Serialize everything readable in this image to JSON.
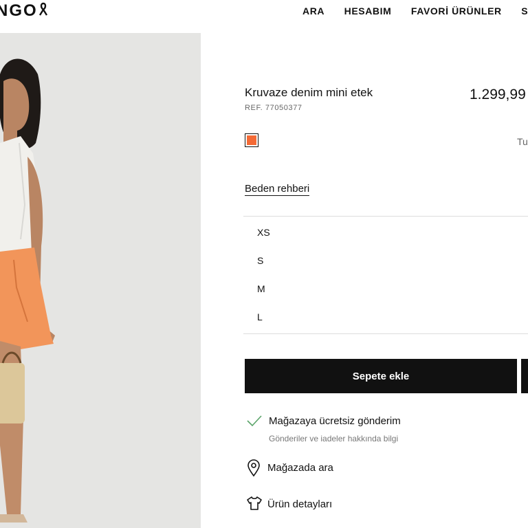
{
  "header": {
    "logo_text": "NGO",
    "nav": [
      {
        "label": "ARA"
      },
      {
        "label": "HESABIM"
      },
      {
        "label": "FAVORİ ÜRÜNLER"
      },
      {
        "label": "SEPE"
      }
    ]
  },
  "product": {
    "title": "Kruvaze denim mini etek",
    "ref": "REF. 77050377",
    "price": "1.299,99",
    "color_swatch": "#f46a36",
    "color_name": "Tu",
    "size_guide": "Beden rehberi",
    "sizes": [
      "XS",
      "S",
      "M",
      "L"
    ],
    "add_to_cart": "Sepete ekle",
    "shipping_title": "Mağazaya ücretsiz gönderim",
    "shipping_sub": "Gönderiler ve iadeler hakkında bilgi",
    "store_search": "Mağazada ara",
    "product_details": "Ürün detayları"
  },
  "icons": {
    "ship": "checkmark-icon",
    "store": "location-pin-icon",
    "details": "tshirt-icon"
  },
  "colors": {
    "accent": "#111111",
    "check": "#5aa469",
    "skirt": "#f2955a"
  }
}
